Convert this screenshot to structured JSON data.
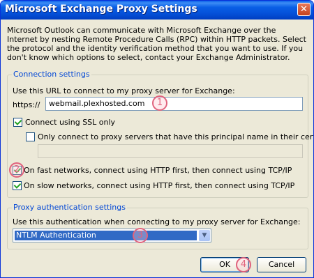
{
  "window": {
    "title": "Microsoft Exchange Proxy Settings"
  },
  "intro": "Microsoft Outlook can communicate with Microsoft Exchange over the Internet by nesting Remote Procedure Calls (RPC) within HTTP packets. Select the protocol and the identity verification method that you want to use. If you don't know which options to select, contact your Exchange Administrator.",
  "connection": {
    "legend": "Connection settings",
    "url_label": "Use this URL to connect to my proxy server for Exchange:",
    "prefix": "https://",
    "url_value": "webmail.plexhosted.com",
    "ssl_label": "Connect using SSL only",
    "ssl_checked": true,
    "principal_label": "Only connect to proxy servers that have this principal name in their certificate:",
    "principal_checked": false,
    "principal_value": "",
    "fast_label": "On fast networks, connect using HTTP first, then connect using TCP/IP",
    "fast_checked": true,
    "slow_label": "On slow networks, connect using HTTP first, then connect using TCP/IP",
    "slow_checked": true
  },
  "auth": {
    "legend": "Proxy authentication settings",
    "label": "Use this authentication when connecting to my proxy server for Exchange:",
    "selected": "NTLM Authentication"
  },
  "buttons": {
    "ok": "OK",
    "cancel": "Cancel"
  },
  "markers": [
    "1",
    "2",
    "3",
    "4"
  ],
  "colors": {
    "title_bar": "#0a5ee8",
    "legend_text": "#0046d5",
    "marker": "#e0637d",
    "selection": "#316ac5"
  }
}
